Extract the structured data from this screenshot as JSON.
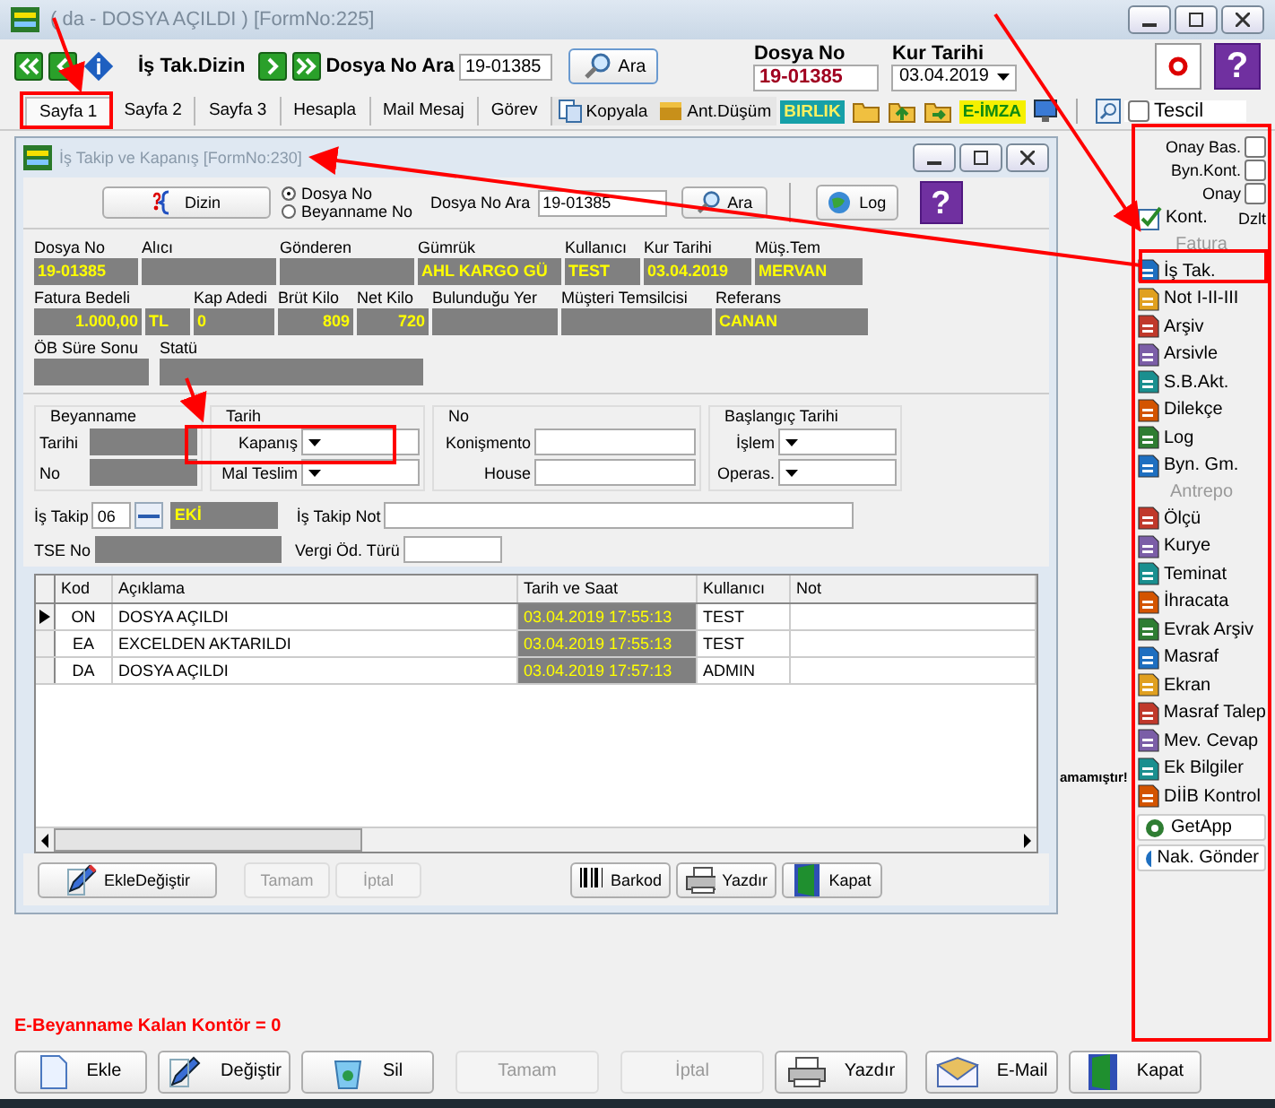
{
  "window": {
    "title": "( da  - DOSYA AÇILDI ) [FormNo:225]"
  },
  "toolbar": {
    "dizin_label": "İş Tak.Dizin",
    "search_label": "Dosya No Ara",
    "search_value": "19-01385",
    "search_button": "Ara",
    "dosya_no_label": "Dosya No",
    "dosya_no": "19-01385",
    "kur_tarihi_label": "Kur Tarihi",
    "kur_tarihi": "03.04.2019",
    "help_button": "?"
  },
  "tabs": [
    {
      "label": "Sayfa 1",
      "selected": true
    },
    {
      "label": "Sayfa 2",
      "selected": false
    },
    {
      "label": "Sayfa 3",
      "selected": false
    },
    {
      "label": "Hesapla",
      "selected": false
    },
    {
      "label": "Mail Mesaj",
      "selected": false
    },
    {
      "label": "Görev",
      "selected": false
    }
  ],
  "tab_tools": {
    "copy": "Kopyala",
    "ant": "Ant.Düşüm",
    "birlik": "BIRLIK",
    "eimza": "E-İMZA",
    "tescil": {
      "label": "Tescil",
      "checked": false
    }
  },
  "side_panel": {
    "checks": [
      {
        "label": "Onay Bas.",
        "checked": false
      },
      {
        "label": "Byn.Kont.",
        "checked": false
      },
      {
        "label": "Onay",
        "checked": false
      }
    ],
    "kont": "Kont.",
    "dzlt": "Dzlt",
    "items": [
      {
        "kind": "section",
        "label": "Fatura"
      },
      {
        "kind": "item",
        "label": "İş Tak."
      },
      {
        "kind": "item",
        "label": "Not I-II-III"
      },
      {
        "kind": "item",
        "label": "Arşiv"
      },
      {
        "kind": "item",
        "label": "Arsivle"
      },
      {
        "kind": "item",
        "label": "S.B.Akt."
      },
      {
        "kind": "item",
        "label": "Dilekçe"
      },
      {
        "kind": "item",
        "label": "Log"
      },
      {
        "kind": "item",
        "label": "Byn. Gm."
      },
      {
        "kind": "section",
        "label": "Antrepo"
      },
      {
        "kind": "item",
        "label": "Ölçü"
      },
      {
        "kind": "item",
        "label": "Kurye"
      },
      {
        "kind": "item",
        "label": "Teminat"
      },
      {
        "kind": "item",
        "label": "İhracata"
      },
      {
        "kind": "item",
        "label": "Evrak Arşiv"
      },
      {
        "kind": "item",
        "label": "Masraf"
      },
      {
        "kind": "item",
        "label": "Ekran"
      },
      {
        "kind": "item",
        "label": "Masraf Talep"
      },
      {
        "kind": "item",
        "label": "Mev. Cevap"
      },
      {
        "kind": "item",
        "label": "Ek Bilgiler"
      },
      {
        "kind": "item",
        "label": "DİİB Kontrol"
      },
      {
        "kind": "button",
        "label": "GetApp"
      },
      {
        "kind": "button",
        "label": "Nak. Gönder"
      }
    ]
  },
  "dialog": {
    "title": "İş Takip ve Kapanış [FormNo:230]",
    "dizin_button": "Dizin",
    "radios": [
      {
        "label": "Dosya No",
        "selected": true
      },
      {
        "label": "Beyanname No",
        "selected": false
      }
    ],
    "search_label": "Dosya No Ara",
    "search_value": "19-01385",
    "search_button": "Ara",
    "log_button": "Log",
    "help_button": "?",
    "fields": [
      [
        {
          "label": "Dosya No",
          "value": "19-01385"
        },
        {
          "label": "Alıcı"
        },
        {
          "label": "Gönderen"
        },
        {
          "label": "Gümrük",
          "value": "AHL KARGO GÜ"
        },
        {
          "label": "Kullanıcı",
          "value": "TEST"
        },
        {
          "label": "Kur Tarihi",
          "value": "03.04.2019"
        },
        {
          "label": "Müş.Tem",
          "value": "MERVAN"
        }
      ],
      [
        {
          "label": "Fatura Bedeli",
          "value": "1.000,00"
        },
        {
          "value": "TL"
        },
        {
          "label": "Kap Adedi",
          "value": "0"
        },
        {
          "label": "Brüt Kilo",
          "value": "809"
        },
        {
          "label": "Net Kilo",
          "value": "720"
        },
        {
          "label": "Bulunduğu Yer"
        },
        {
          "label": "Müşteri Temsilcisi"
        },
        {
          "label": "Referans",
          "value": "CANAN"
        }
      ],
      [
        {
          "label": "ÖB Süre Sonu"
        },
        {
          "label": "Statü"
        }
      ]
    ],
    "groups": [
      {
        "title": "Beyanname",
        "kind": "readonly",
        "rows": [
          "Tarihi",
          "No"
        ]
      },
      {
        "title": "Tarih",
        "kind": "combo",
        "rows": [
          "Kapanış",
          "Mal Teslim"
        ]
      },
      {
        "title": "No",
        "kind": "input",
        "rows": [
          "Konişmento",
          "House"
        ]
      },
      {
        "title": "Başlangıç Tarihi",
        "kind": "combo",
        "rows": [
          "İşlem",
          "Operas."
        ]
      }
    ],
    "is_takip": {
      "label": "İş Takip",
      "code": "06",
      "value": "EKİ",
      "note_label": "İş Takip Not"
    },
    "tse_label": "TSE No",
    "vergi_label": "Vergi Öd. Türü",
    "table": {
      "columns": [
        "Kod",
        "Açıklama",
        "Tarih ve Saat",
        "Kullanıcı",
        "Not"
      ],
      "rows": [
        {
          "selected": true,
          "cells": [
            "ON",
            "DOSYA AÇILDI",
            "03.04.2019 17:55:13",
            "TEST"
          ]
        },
        {
          "selected": false,
          "cells": [
            "EA",
            "EXCELDEN AKTARILDI",
            "03.04.2019 17:55:13",
            "TEST"
          ]
        },
        {
          "selected": false,
          "cells": [
            "DA",
            "DOSYA AÇILDI",
            "03.04.2019 17:57:13",
            "ADMIN"
          ]
        }
      ]
    },
    "buttons": [
      {
        "label": "EkleDeğiştir",
        "disabled": false
      },
      {
        "label": "Tamam",
        "disabled": true
      },
      {
        "label": "İptal",
        "disabled": true
      },
      {
        "label": "Barkod",
        "disabled": false
      },
      {
        "label": "Yazdır",
        "disabled": false
      },
      {
        "label": "Kapat",
        "disabled": false
      }
    ]
  },
  "hidden_message": "amamıştır!",
  "status_text": "E-Beyanname Kalan Kontör = 0",
  "bottom_buttons": [
    {
      "label": "Ekle",
      "disabled": false
    },
    {
      "label": "Değiştir",
      "disabled": false
    },
    {
      "label": "Sil",
      "disabled": false
    },
    {
      "label": "Tamam",
      "disabled": true
    },
    {
      "label": "İptal",
      "disabled": true
    },
    {
      "label": "Yazdır",
      "disabled": false
    },
    {
      "label": "E-Mail",
      "disabled": false
    },
    {
      "label": "Kapat",
      "disabled": false
    }
  ]
}
